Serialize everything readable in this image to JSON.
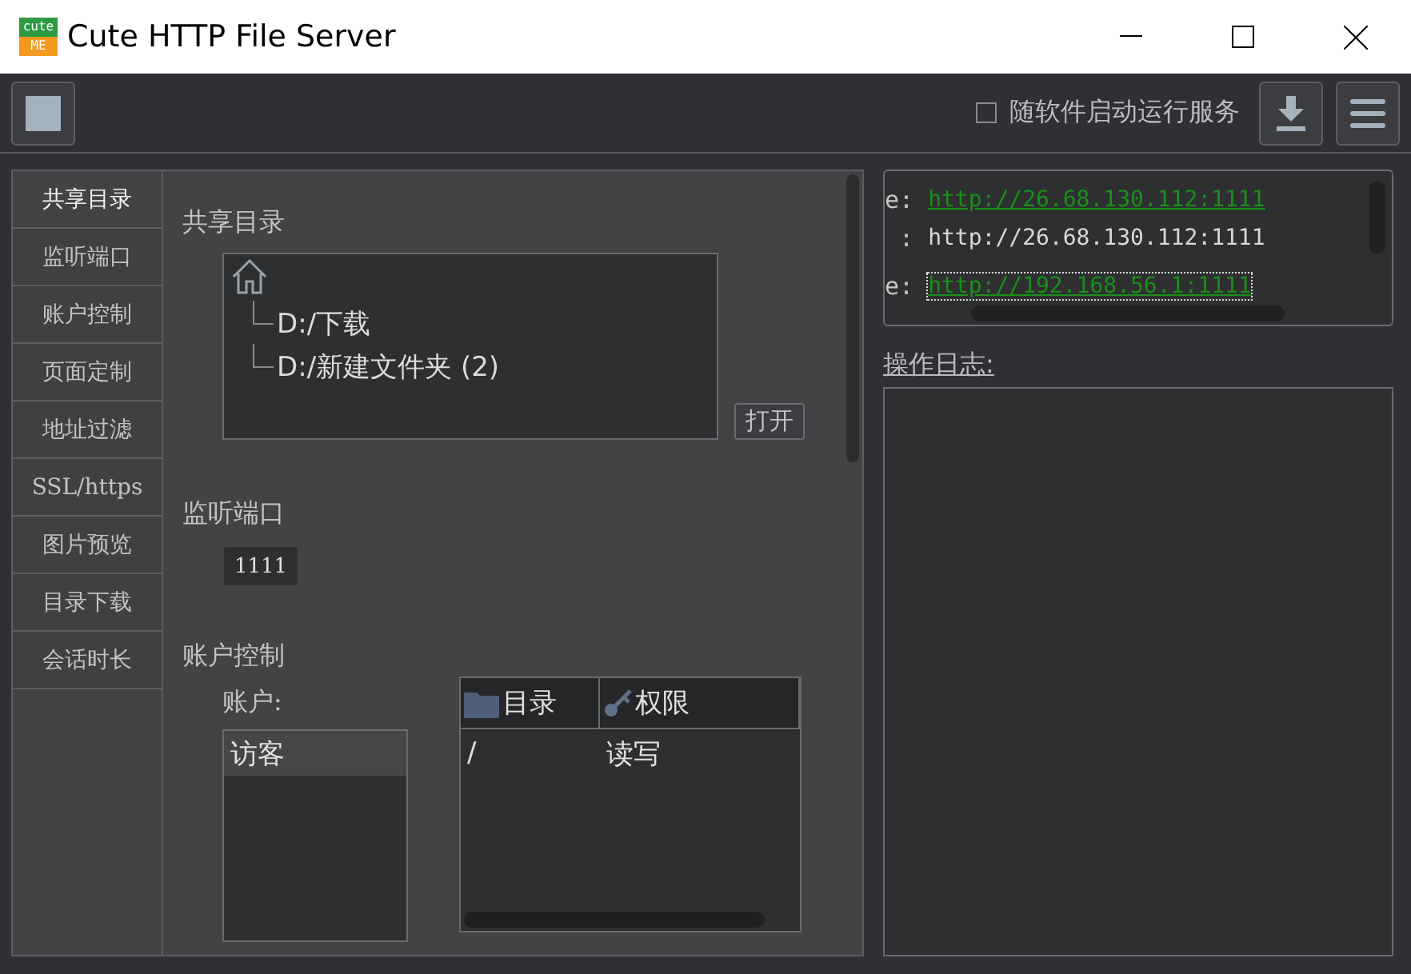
{
  "window": {
    "logo_top": "cute",
    "logo_bottom": "ME",
    "title": "Cute HTTP File Server"
  },
  "toolbar": {
    "autostart": {
      "label": "随软件启动运行服务",
      "checked": false
    }
  },
  "tabs": [
    {
      "label": "共享目录",
      "selected": true
    },
    {
      "label": "监听端口",
      "selected": false
    },
    {
      "label": "账户控制",
      "selected": false
    },
    {
      "label": "页面定制",
      "selected": false
    },
    {
      "label": "地址过滤",
      "selected": false
    },
    {
      "label": "SSL/https",
      "selected": false
    },
    {
      "label": "图片预览",
      "selected": false
    },
    {
      "label": "目录下载",
      "selected": false
    },
    {
      "label": "会话时长",
      "selected": false
    }
  ],
  "share": {
    "heading": "共享目录",
    "tree": {
      "children": [
        {
          "label": "D:/下载"
        },
        {
          "label": "D:/新建文件夹 (2)"
        }
      ]
    },
    "open_button": "打开"
  },
  "port": {
    "heading": "监听端口",
    "value": "1111"
  },
  "accounts": {
    "heading": "账户控制",
    "list_label": "账户:",
    "items": [
      {
        "label": "访客",
        "selected": true
      }
    ],
    "table": {
      "columns": [
        "目录",
        "权限"
      ],
      "rows": [
        [
          "/",
          "读写"
        ]
      ]
    }
  },
  "addresses": [
    {
      "prefix": "e:",
      "url": "http://26.68.130.112:1111",
      "kind": "link",
      "focused": false
    },
    {
      "prefix": " :",
      "url": "http://26.68.130.112:1111",
      "kind": "plain",
      "focused": false
    },
    {
      "prefix": "e:",
      "url": "http://192.168.56.1:1111",
      "kind": "link",
      "focused": true
    }
  ],
  "log": {
    "label": "操作日志:"
  }
}
